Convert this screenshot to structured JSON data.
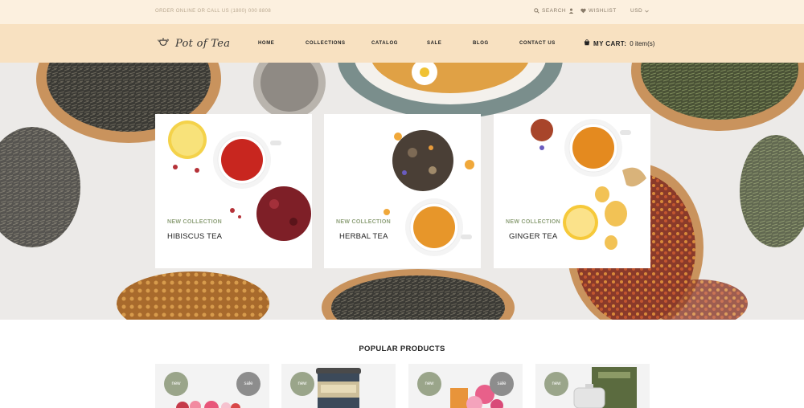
{
  "topbar": {
    "phone_text": "ORDER ONLINE OR CALL US (1800) 000 8808",
    "search_label": "SEARCH",
    "wishlist_label": "WISHLIST",
    "currency": "USD"
  },
  "header": {
    "logo_text": "Pot of Tea",
    "nav": [
      "HOME",
      "COLLECTIONS",
      "CATALOG",
      "SALE",
      "BLOG",
      "CONTACT US"
    ],
    "cart_label": "MY CART:",
    "cart_count": "0 item(s)"
  },
  "hero": {
    "cards": [
      {
        "eyebrow": "NEW COLLECTION",
        "name": "HIBISCUS TEA"
      },
      {
        "eyebrow": "NEW COLLECTION",
        "name": "HERBAL TEA"
      },
      {
        "eyebrow": "NEW COLLECTION",
        "name": "GINGER TEA"
      }
    ]
  },
  "popular": {
    "title": "POPULAR PRODUCTS",
    "badges": {
      "new": "new",
      "sale": "sale"
    }
  },
  "colors": {
    "topbar_bg": "#fcf0df",
    "header_bg": "#f8e1c1",
    "accent_green": "#8fa17a",
    "badge_new": "#9aa58a",
    "badge_sale": "#8d8d8d"
  }
}
